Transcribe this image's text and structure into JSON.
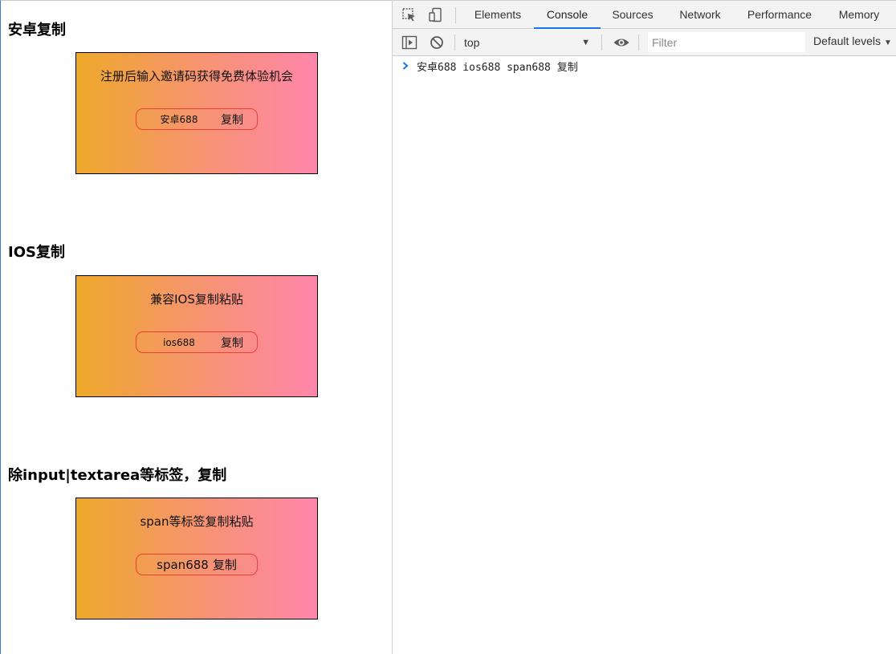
{
  "page": {
    "sections": [
      {
        "title": "安卓复制",
        "card_text": "注册后输入邀请码获得免费体验机会",
        "code_value": "安卓688",
        "copy_label": "复制"
      },
      {
        "title": "IOS复制",
        "card_text": "兼容IOS复制粘贴",
        "code_value": "ios688",
        "copy_label": "复制"
      },
      {
        "title": "除input|textarea等标签，复制",
        "card_text": "span等标签复制粘贴",
        "code_value": "span688",
        "copy_label": "复制"
      }
    ],
    "card_gradient": [
      "#eea92a",
      "#fe85ab"
    ],
    "pill_border_color": "#e8413a"
  },
  "devtools": {
    "tabs": [
      "Elements",
      "Console",
      "Sources",
      "Network",
      "Performance",
      "Memory"
    ],
    "active_tab": "Console",
    "context": "top",
    "filter_placeholder": "Filter",
    "levels_label": "Default levels",
    "console_lines": [
      "安卓688 ios688 span688 复制"
    ],
    "accent_color": "#1a73e8"
  }
}
